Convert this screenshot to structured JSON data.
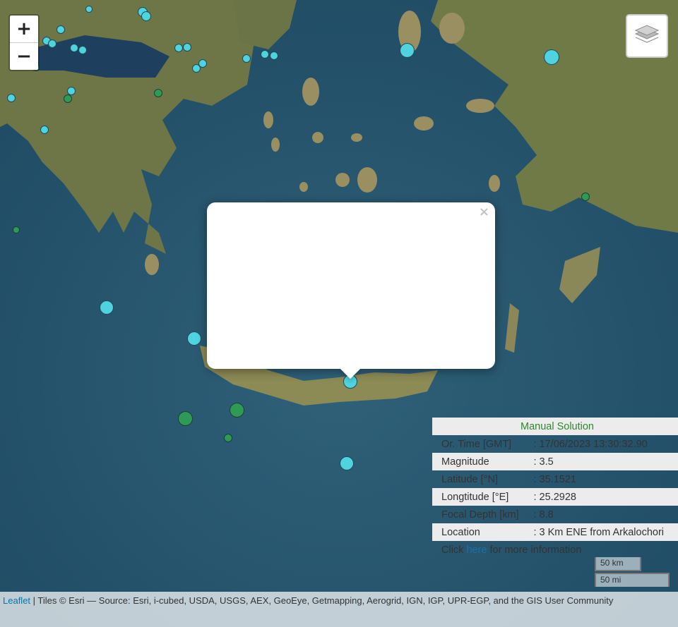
{
  "controls": {
    "zoom_in": "+",
    "zoom_out": "−"
  },
  "popup": {
    "title": "Manual Solution",
    "rows": [
      {
        "label": "Or. Time [GMT]",
        "value": ": 17/06/2023 13:30:32.90"
      },
      {
        "label": "Magnitude",
        "value": ": 3.5"
      },
      {
        "label": "Latitude [°N]",
        "value": ": 35.1521"
      },
      {
        "label": "Longtitude [°E]",
        "value": ": 25.2928"
      },
      {
        "label": "Focal Depth [km]",
        "value": ": 8.8"
      },
      {
        "label": "Location",
        "value": ": 3 Km ENE from Arkalochori"
      }
    ],
    "more_pre": "Click ",
    "more_link": "here",
    "more_post": " for more information",
    "close": "×"
  },
  "scale": {
    "km": "50 km",
    "mi": "50 mi"
  },
  "attribution": {
    "leaflet": "Leaflet",
    "text": " | Tiles © Esri — Source: Esri, i-cubed, USDA, USGS, AEX, GeoEye, Getmapping, Aerogrid, IGN, IGP, UPR-EGP, and the GIS User Community"
  },
  "colors": {
    "cyan_marker": "#4fd3de",
    "green_marker": "#2f9a55",
    "sea": "#2b5a73",
    "land": "#6f7c4a"
  },
  "markers_note_icons": "earthquake-event markers"
}
